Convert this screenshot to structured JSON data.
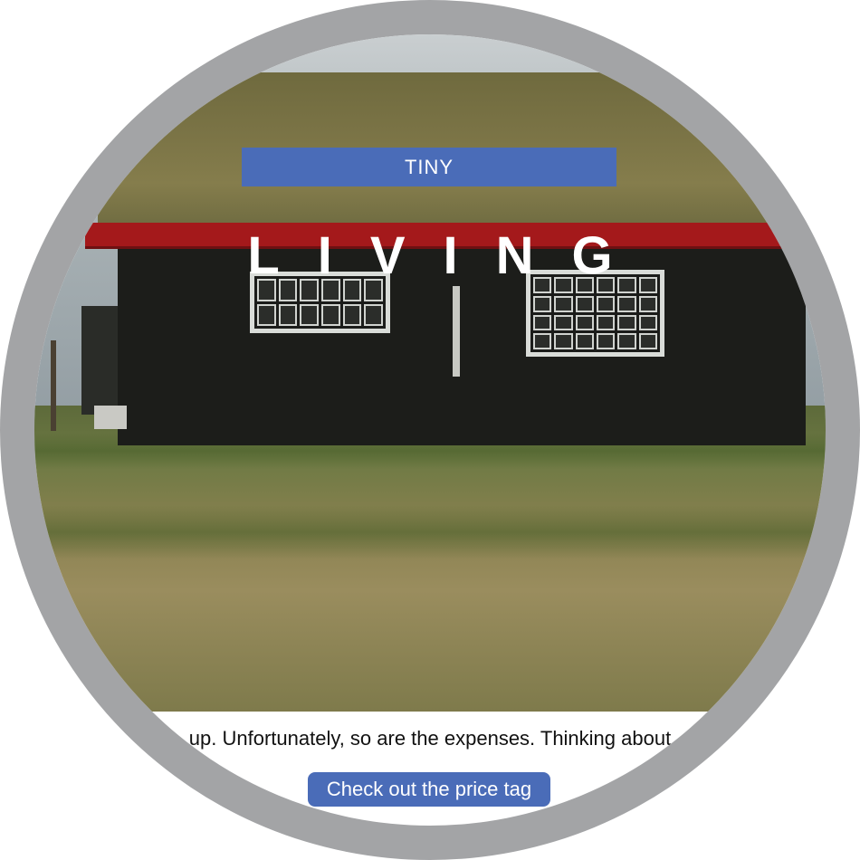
{
  "hero": {
    "badge": "TINY",
    "headline": "LIVING"
  },
  "body": {
    "caption": "up. Unfortunately, so are the expenses. Thinking about"
  },
  "cta": {
    "label": "Check out the price tag"
  },
  "colors": {
    "accent": "#4a6cb8",
    "frame": "#a3a4a6",
    "roof_trim": "#a4191b"
  }
}
